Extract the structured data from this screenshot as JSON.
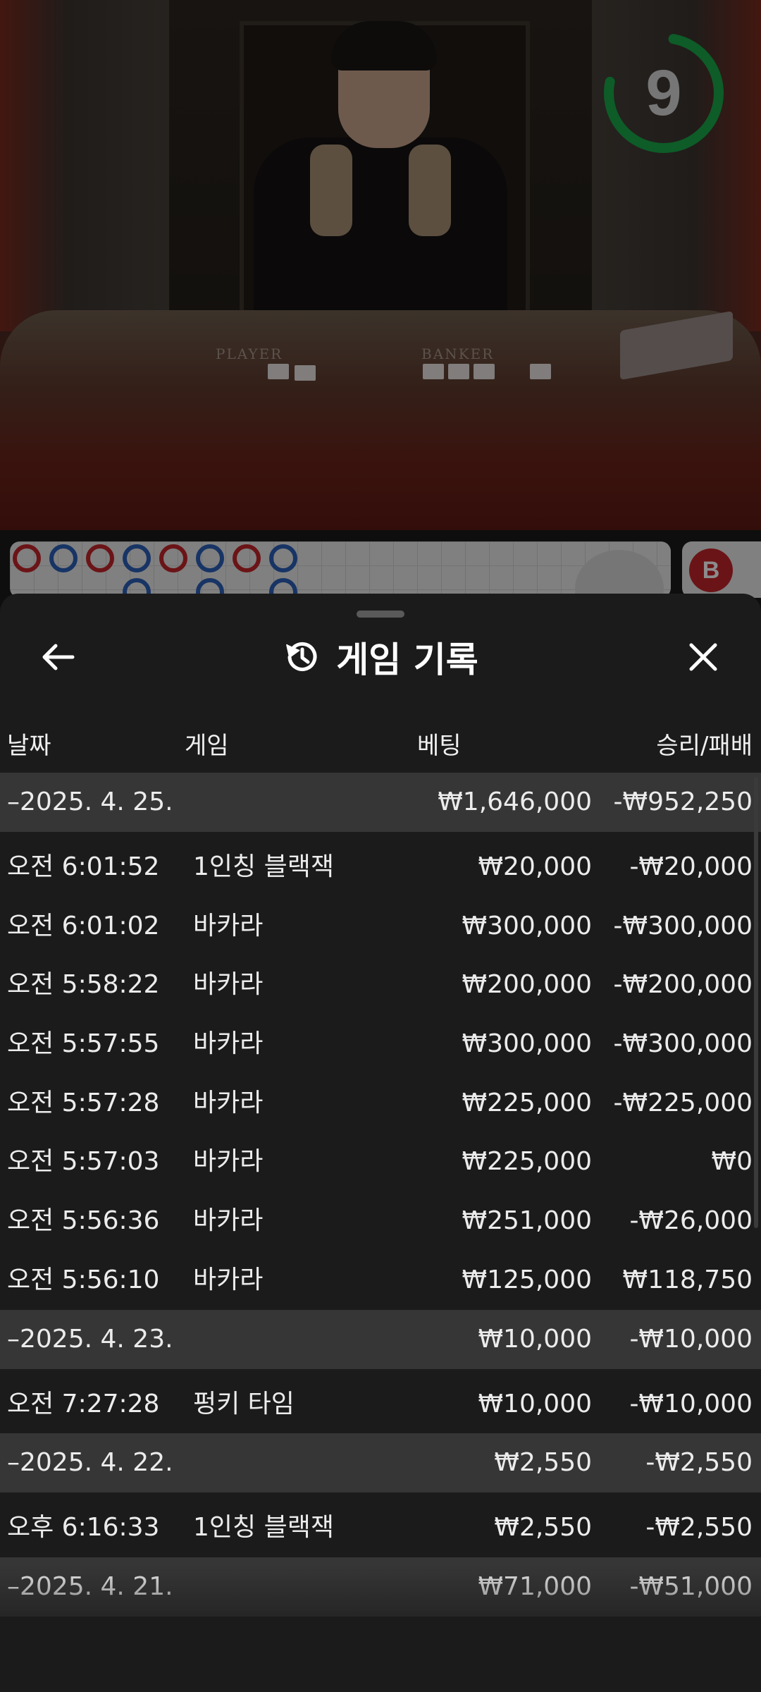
{
  "game": {
    "timer_value": "9",
    "table_labels": {
      "player": "PLAYER",
      "banker": "BANKER"
    },
    "roadmap_chip": "B",
    "colors": {
      "timer": "#1aa84a",
      "banker_red": "#c3262b",
      "player_blue": "#2a5fb8"
    }
  },
  "sheet": {
    "title": "게임 기록",
    "icons": {
      "back": "arrow-left-icon",
      "history": "history-icon",
      "close": "close-icon"
    },
    "columns": {
      "date": "날짜",
      "game": "게임",
      "bet": "베팅",
      "result": "승리/패배"
    },
    "rows": [
      {
        "type": "group",
        "date": "–2025. 4. 25.",
        "game": "",
        "bet": "₩1,646,000",
        "result": "-₩952,250"
      },
      {
        "type": "item",
        "date": "오전 6:01:52",
        "game": "1인칭 블랙잭",
        "bet": "₩20,000",
        "result": "-₩20,000"
      },
      {
        "type": "item",
        "date": "오전 6:01:02",
        "game": "바카라",
        "bet": "₩300,000",
        "result": "-₩300,000"
      },
      {
        "type": "item",
        "date": "오전 5:58:22",
        "game": "바카라",
        "bet": "₩200,000",
        "result": "-₩200,000"
      },
      {
        "type": "item",
        "date": "오전 5:57:55",
        "game": "바카라",
        "bet": "₩300,000",
        "result": "-₩300,000"
      },
      {
        "type": "item",
        "date": "오전 5:57:28",
        "game": "바카라",
        "bet": "₩225,000",
        "result": "-₩225,000"
      },
      {
        "type": "item",
        "date": "오전 5:57:03",
        "game": "바카라",
        "bet": "₩225,000",
        "result": "₩0"
      },
      {
        "type": "item",
        "date": "오전 5:56:36",
        "game": "바카라",
        "bet": "₩251,000",
        "result": "-₩26,000"
      },
      {
        "type": "item",
        "date": "오전 5:56:10",
        "game": "바카라",
        "bet": "₩125,000",
        "result": "₩118,750"
      },
      {
        "type": "group",
        "date": "–2025. 4. 23.",
        "game": "",
        "bet": "₩10,000",
        "result": "-₩10,000"
      },
      {
        "type": "item",
        "date": "오전 7:27:28",
        "game": "펑키 타임",
        "bet": "₩10,000",
        "result": "-₩10,000"
      },
      {
        "type": "group",
        "date": "–2025. 4. 22.",
        "game": "",
        "bet": "₩2,550",
        "result": "-₩2,550"
      },
      {
        "type": "item",
        "date": "오후 6:16:33",
        "game": "1인칭 블랙잭",
        "bet": "₩2,550",
        "result": "-₩2,550"
      },
      {
        "type": "group",
        "date": "–2025. 4. 21.",
        "game": "",
        "bet": "₩71,000",
        "result": "-₩51,000"
      }
    ]
  }
}
